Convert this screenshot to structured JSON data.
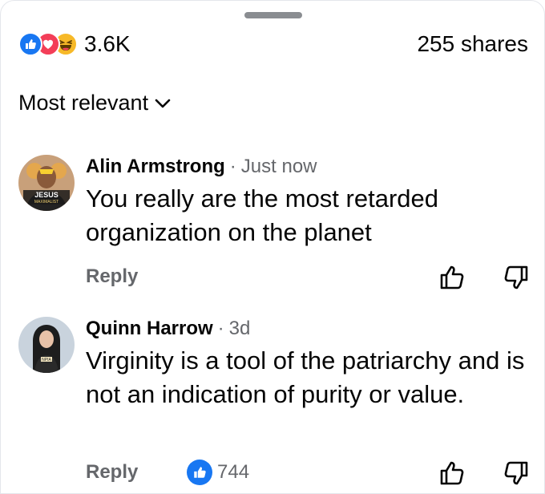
{
  "reactions": {
    "types": [
      "like",
      "love",
      "haha"
    ],
    "count": "3.6K",
    "shares": "255 shares"
  },
  "sort": {
    "label": "Most relevant"
  },
  "comments": [
    {
      "author": "Alin Armstrong",
      "time": "Just now",
      "text": "You really are the most retarded organization on the planet",
      "reply_label": "Reply",
      "avatar_text": "JESUS MAXIMALIST",
      "likes": null
    },
    {
      "author": "Quinn Harrow",
      "time": "3d",
      "text": "Virginity is a tool of the patriarchy and is not an indication of purity or value.",
      "reply_label": "Reply",
      "likes": "744"
    }
  ],
  "colors": {
    "accent": "#1877f2",
    "love": "#f33e58",
    "haha": "#f7b928",
    "muted": "#65676b"
  }
}
